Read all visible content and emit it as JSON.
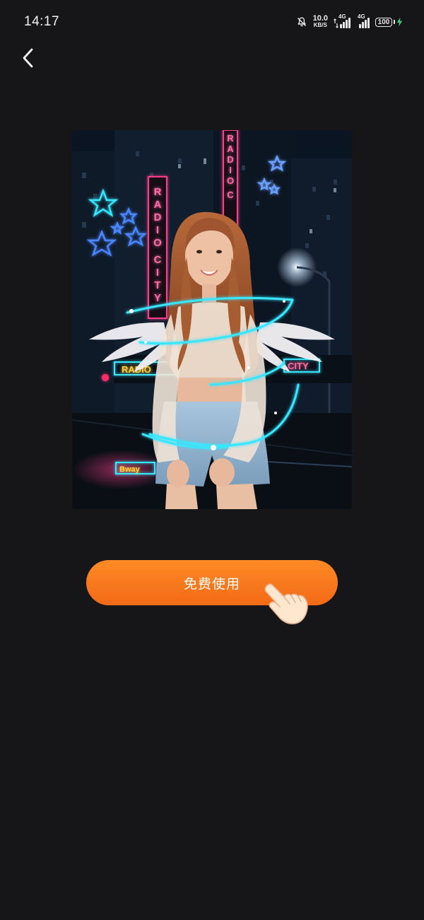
{
  "status_bar": {
    "time": "14:17",
    "net_speed_value": "10.0",
    "net_speed_unit": "KB/S",
    "signal_1_label": "4G",
    "signal_2_label": "4G",
    "battery_level": "100",
    "icons": [
      "mute-bell-icon",
      "data-arrows-icon",
      "signal-icon",
      "battery-icon",
      "charging-bolt-icon"
    ]
  },
  "nav": {
    "back_icon": "chevron-left-icon"
  },
  "preview": {
    "sign_left": "RADIO CITY",
    "sign_right": "RADIO C",
    "marquee_right": "CITY",
    "marquee_left": "RADIO",
    "neon_colors": {
      "pink": "#ff3d8b",
      "cyan": "#39e6ff",
      "blue": "#4a86ff"
    }
  },
  "cta": {
    "label": "免费使用",
    "color_top": "#ff8a24",
    "color_bottom": "#f26a17",
    "hand_icon": "pointing-hand-icon"
  }
}
